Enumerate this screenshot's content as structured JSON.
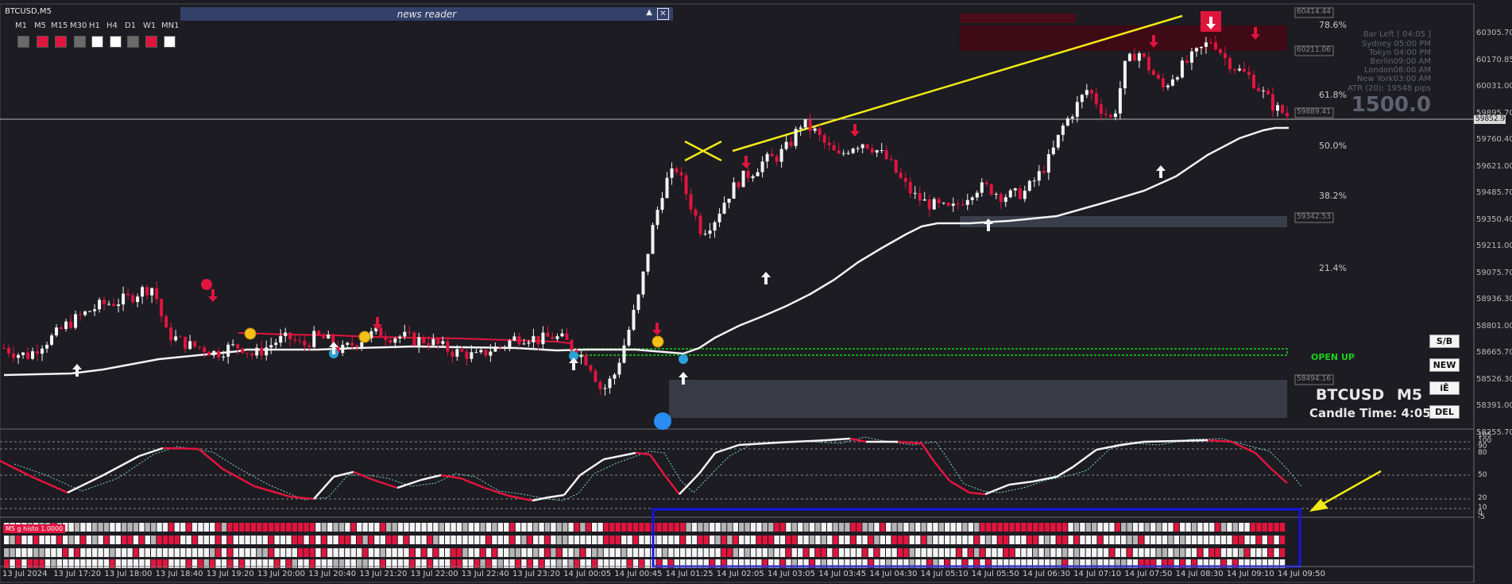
{
  "window": {
    "title": "BTCUSD,M5"
  },
  "timeframes": {
    "labels": [
      "M1",
      "M5",
      "M15",
      "M30",
      "H1",
      "H4",
      "D1",
      "W1",
      "MN1"
    ],
    "colors": [
      "#6a6a6a",
      "#e0153e",
      "#e0153e",
      "#6a6a6a",
      "#ffffff",
      "#ffffff",
      "#6a6a6a",
      "#e0153e",
      "#ffffff"
    ]
  },
  "news_reader": {
    "title": "news reader",
    "minimize_icon": "up-triangle-icon",
    "close_icon": "close-icon"
  },
  "info_panel": {
    "bar_left": "Bar Left  [ 04:05 ]",
    "sydney": "Sydney 05:00 PM",
    "tokyo": "Tokyo 04:00 PM",
    "berlin": "Berlin09:00 AM",
    "london": "London08:00 AM",
    "new_york": "New York03:00 AM",
    "atr": "ATR (20): 19548 pips",
    "big_value": "1500.0"
  },
  "fib_levels": [
    "78.6%",
    "61.8%",
    "50.0%",
    "38.2%",
    "21.4%"
  ],
  "price_axis": [
    "60305.70",
    "60170.85",
    "60031.00",
    "59895.70",
    "59760.40",
    "59621.00",
    "59485.70",
    "59350.40",
    "59211.00",
    "59075.70",
    "58936.30",
    "58801.00",
    "58665.70",
    "58526.30",
    "58391.00",
    "58255.70"
  ],
  "price_tags": {
    "top": "60414.44",
    "upper_zone": "60211.06",
    "fib_618": "59889.41",
    "current": "59852.93",
    "demand_zone": "59342.53",
    "lower_zone": "58494.16"
  },
  "open_up_label": "OPEN UP",
  "symbol_panel": {
    "symbol": "BTCUSD",
    "timeframe": "M5",
    "candle_time": "Candle Time: 4:05"
  },
  "side_buttons": [
    "S/B",
    "NEW",
    "iÊ",
    "DEL"
  ],
  "oscillator_axis": [
    "105",
    "100",
    "90",
    "80",
    "50",
    "20",
    "10",
    "0",
    "-5"
  ],
  "histo_label": "M5 g  histo  1.0000",
  "time_axis": [
    "13 Jul 2024",
    "13 Jul 17:20",
    "13 Jul 18:00",
    "13 Jul 18:40",
    "13 Jul 19:20",
    "13 Jul 20:00",
    "13 Jul 20:40",
    "13 Jul 21:20",
    "13 Jul 22:00",
    "13 Jul 22:40",
    "13 Jul 23:20",
    "14 Jul 00:05",
    "14 Jul 00:45",
    "14 Jul 01:25",
    "14 Jul 02:05",
    "14 Jul 03:05",
    "14 Jul 03:45",
    "14 Jul 04:30",
    "14 Jul 05:10",
    "14 Jul 05:50",
    "14 Jul 06:30",
    "14 Jul 07:10",
    "14 Jul 07:50",
    "14 Jul 08:30",
    "14 Jul 09:10",
    "14 Jul 09:50"
  ],
  "chart_data": {
    "type": "candlestick",
    "symbol": "BTCUSD",
    "timeframe": "M5",
    "ylim": [
      58255.7,
      60414.44
    ],
    "close_path": [
      58640,
      58610,
      58600,
      58660,
      58700,
      58760,
      58800,
      58840,
      58870,
      58880,
      58900,
      58940,
      58960,
      58720,
      58680,
      58650,
      58640,
      58610,
      58640,
      58650,
      58600,
      58640,
      58680,
      58690,
      58650,
      58700,
      58680,
      58620,
      58660,
      58700,
      58720,
      58700,
      58700,
      58680,
      58680,
      58650,
      58620,
      58610,
      58590,
      58630,
      58650,
      58690,
      58700,
      58680,
      58700,
      58680,
      58620,
      58560,
      58410,
      58500,
      58700,
      58920,
      59250,
      59500,
      59580,
      59410,
      59250,
      59310,
      59430,
      59520,
      59560,
      59620,
      59640,
      59700,
      59820,
      59780,
      59700,
      59640,
      59700,
      59720,
      59680,
      59620,
      59520,
      59440,
      59400,
      59380,
      59360,
      59420,
      59480,
      59480,
      59440,
      59440,
      59460,
      59540,
      59640,
      59800,
      59900,
      60000,
      59900,
      59830,
      60120,
      60200,
      60100,
      60000,
      60080,
      60140,
      60200,
      60260,
      60160,
      60100,
      60060,
      59980,
      59900,
      59860
    ]
  }
}
